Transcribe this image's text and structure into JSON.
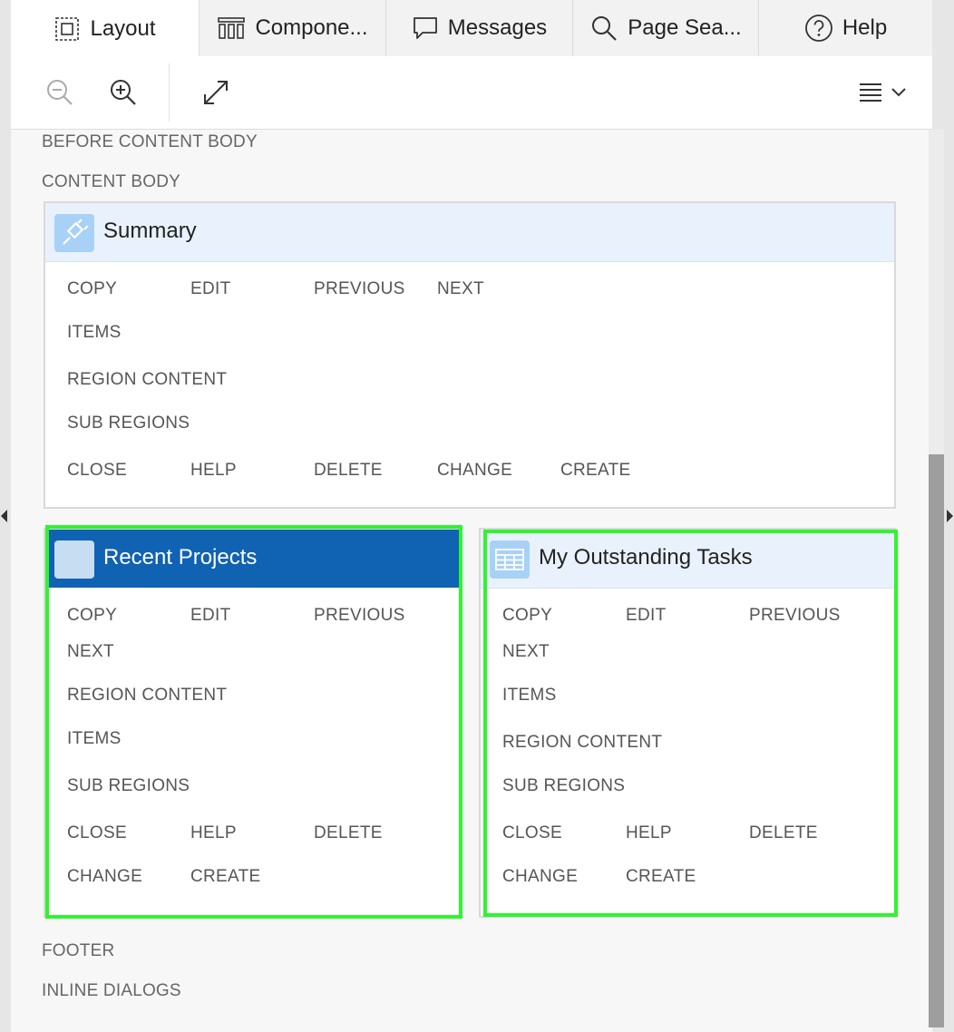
{
  "tabs": [
    {
      "label": "Layout",
      "icon": "layout-icon",
      "active": true
    },
    {
      "label": "Compone...",
      "icon": "columns-icon"
    },
    {
      "label": "Messages",
      "icon": "speech-bubble-icon"
    },
    {
      "label": "Page Sea...",
      "icon": "search-icon"
    },
    {
      "label": "Help",
      "icon": "help-circle-icon"
    }
  ],
  "toolbar": {
    "zoom_out": "zoom-out-icon",
    "zoom_in": "zoom-in-icon",
    "expand": "expand-icon",
    "menu": "menu-icon"
  },
  "sections": {
    "before_content_body": "BEFORE CONTENT BODY",
    "content_body": "CONTENT BODY",
    "footer": "FOOTER",
    "inline_dialogs": "INLINE DIALOGS"
  },
  "regions": {
    "summary": {
      "title": "Summary",
      "icon": "plug-icon",
      "labels": {
        "copy": "COPY",
        "edit": "EDIT",
        "previous": "PREVIOUS",
        "next": "NEXT",
        "items": "ITEMS",
        "region_content": "REGION CONTENT",
        "sub_regions": "SUB REGIONS",
        "close": "CLOSE",
        "help": "HELP",
        "delete": "DELETE",
        "change": "CHANGE",
        "create": "CREATE"
      }
    },
    "recent_projects": {
      "title": "Recent Projects",
      "icon": "blank-region-icon",
      "selected": true,
      "labels": {
        "copy": "COPY",
        "edit": "EDIT",
        "previous": "PREVIOUS",
        "next": "NEXT",
        "region_content": "REGION CONTENT",
        "items": "ITEMS",
        "sub_regions": "SUB REGIONS",
        "close": "CLOSE",
        "help": "HELP",
        "delete": "DELETE",
        "change": "CHANGE",
        "create": "CREATE"
      }
    },
    "my_outstanding_tasks": {
      "title": "My Outstanding Tasks",
      "icon": "table-icon",
      "labels": {
        "copy": "COPY",
        "edit": "EDIT",
        "previous": "PREVIOUS",
        "next": "NEXT",
        "items": "ITEMS",
        "region_content": "REGION CONTENT",
        "sub_regions": "SUB REGIONS",
        "close": "CLOSE",
        "help": "HELP",
        "delete": "DELETE",
        "change": "CHANGE",
        "create": "CREATE"
      }
    }
  },
  "colors": {
    "selected_header": "#1062b3",
    "region_header": "#e9f2fc",
    "highlight_outline": "#2ef52e"
  }
}
